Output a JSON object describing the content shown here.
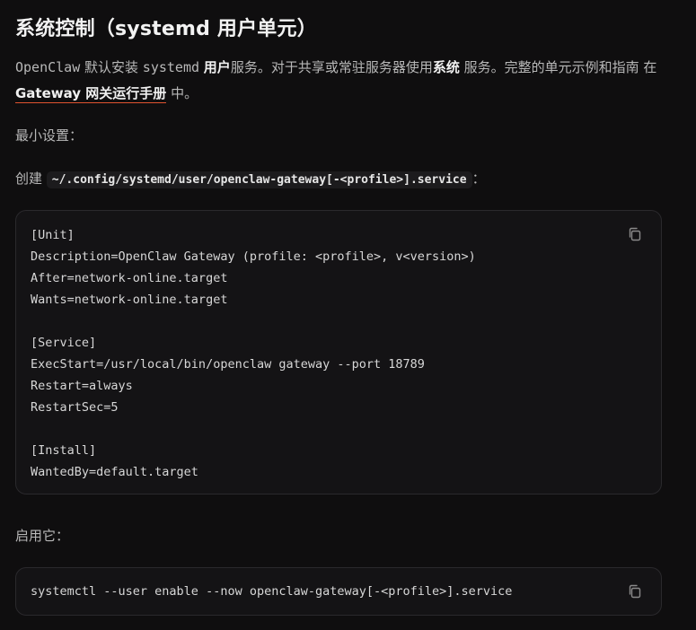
{
  "heading": "系统控制（systemd 用户单元）",
  "intro": {
    "part1": "OpenClaw",
    "part2": " 默认安装 ",
    "part3": "systemd",
    "bold1": "用户",
    "part4": "服务。对于共享或常驻服务器使用",
    "bold2": "系统",
    "part5": " 服务。完整的单元示例和指南 在 ",
    "link": "Gateway 网关运行手册",
    "part6": " 中。"
  },
  "minimal_setup_label": "最小设置：",
  "create": {
    "prefix": "创建 ",
    "path": "~/.config/systemd/user/openclaw-gateway[-<profile>].service",
    "suffix": "："
  },
  "unit_file": "[Unit]\nDescription=OpenClaw Gateway (profile: <profile>, v<version>)\nAfter=network-online.target\nWants=network-online.target\n\n[Service]\nExecStart=/usr/local/bin/openclaw gateway --port 18789\nRestart=always\nRestartSec=5\n\n[Install]\nWantedBy=default.target",
  "enable_label": "启用它：",
  "enable_command": "systemctl --user enable --now openclaw-gateway[-<profile>].service",
  "icons": {
    "copy": "copy-icon"
  },
  "colors": {
    "background": "#0f0e0f",
    "link_underline": "#e0532f",
    "code_background": "#141315"
  }
}
